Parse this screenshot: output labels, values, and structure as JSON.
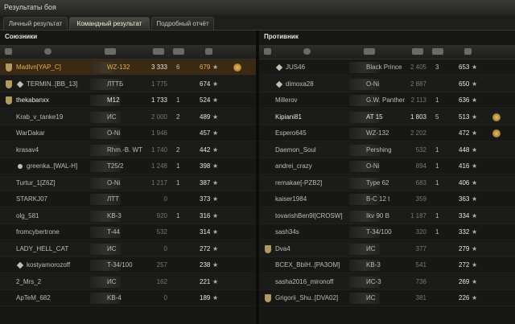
{
  "window": {
    "title": "Результаты боя"
  },
  "tabs": [
    {
      "label": "Личный результат"
    },
    {
      "label": "Командный результат"
    },
    {
      "label": "Подробный отчёт"
    }
  ],
  "allies": {
    "title": "Союзники",
    "rows": [
      {
        "name": "Madlvn[YAP_C]",
        "tank": "WZ-132",
        "damage": "3 333",
        "frags": "6",
        "xp": "679",
        "badge": true,
        "medal": true,
        "style": "me"
      },
      {
        "name": "TERMIN..[BB_13]",
        "tank": "ЛТТБ",
        "damage": "1 775",
        "frags": "",
        "xp": "674",
        "badge": true,
        "diamond": true,
        "style": "normal"
      },
      {
        "name": "thekabanxx",
        "tank": "M12",
        "damage": "1 733",
        "frags": "1",
        "xp": "524",
        "badge": true,
        "style": "bright"
      },
      {
        "name": "Krab_v_tanke19",
        "tank": "ИС",
        "damage": "2 000",
        "frags": "2",
        "xp": "489",
        "style": "normal"
      },
      {
        "name": "WarDakar",
        "tank": "O-Ni",
        "damage": "1 946",
        "frags": "",
        "xp": "457",
        "style": "normal"
      },
      {
        "name": "krasav4",
        "tank": "Rhm.-B. WT",
        "damage": "1 740",
        "frags": "2",
        "xp": "442",
        "style": "normal"
      },
      {
        "name": "greenka..[WAL-H]",
        "tank": "T25/2",
        "damage": "1 248",
        "frags": "1",
        "xp": "398",
        "icon": true,
        "style": "normal"
      },
      {
        "name": "Turtur_1[Z6Z]",
        "tank": "O-Ni",
        "damage": "1 217",
        "frags": "1",
        "xp": "387",
        "style": "normal"
      },
      {
        "name": "STARKJ07",
        "tank": "ЛТТ",
        "damage": "0",
        "frags": "",
        "xp": "373",
        "style": "normal"
      },
      {
        "name": "olg_581",
        "tank": "KB-3",
        "damage": "920",
        "frags": "1",
        "xp": "316",
        "style": "normal"
      },
      {
        "name": "fromcybertrone",
        "tank": "T-44",
        "damage": "532",
        "frags": "",
        "xp": "314",
        "style": "normal"
      },
      {
        "name": "LADY_HELL_CAT",
        "tank": "ИС",
        "damage": "0",
        "frags": "",
        "xp": "272",
        "style": "normal"
      },
      {
        "name": "kostyamorozoff",
        "tank": "T-34/100",
        "damage": "257",
        "frags": "",
        "xp": "238",
        "diamond": true,
        "style": "normal"
      },
      {
        "name": "2_Mrs_2",
        "tank": "ИС",
        "damage": "162",
        "frags": "",
        "xp": "221",
        "style": "normal"
      },
      {
        "name": "ApTeM_682",
        "tank": "KB-4",
        "damage": "0",
        "frags": "",
        "xp": "189",
        "style": "normal"
      }
    ]
  },
  "enemies": {
    "title": "Противник",
    "rows": [
      {
        "name": "JUS46",
        "tank": "Black Prince",
        "damage": "2 405",
        "frags": "3",
        "xp": "653",
        "diamond": true,
        "style": "normal"
      },
      {
        "name": "dimoxa28",
        "tank": "O-Ni",
        "damage": "2 887",
        "frags": "",
        "xp": "650",
        "diamond": true,
        "style": "normal"
      },
      {
        "name": "Millerov",
        "tank": "G.W. Panther",
        "damage": "2 113",
        "frags": "1",
        "xp": "636",
        "style": "normal"
      },
      {
        "name": "Kipiani81",
        "tank": "AT 15",
        "damage": "1 803",
        "frags": "5",
        "xp": "513",
        "medal": true,
        "style": "bright"
      },
      {
        "name": "Espero645",
        "tank": "WZ-132",
        "damage": "2 202",
        "frags": "",
        "xp": "472",
        "medal": true,
        "style": "normal"
      },
      {
        "name": "Daemon_Soul",
        "tank": "Pershing",
        "damage": "532",
        "frags": "1",
        "xp": "448",
        "style": "normal"
      },
      {
        "name": "andrei_crazy",
        "tank": "O-Ni",
        "damage": "894",
        "frags": "1",
        "xp": "416",
        "style": "normal"
      },
      {
        "name": "remakae[-PZB2]",
        "tank": "Type 62",
        "damage": "683",
        "frags": "1",
        "xp": "406",
        "style": "normal"
      },
      {
        "name": "kaiser1984",
        "tank": "B-C 12 t",
        "damage": "359",
        "frags": "",
        "xp": "363",
        "style": "normal"
      },
      {
        "name": "tovarishBen9l[CROSW]",
        "tank": "Ikv 90 B",
        "damage": "1 187",
        "frags": "1",
        "xp": "334",
        "style": "normal"
      },
      {
        "name": "sash34s",
        "tank": "T-34/100",
        "damage": "320",
        "frags": "1",
        "xp": "332",
        "style": "normal"
      },
      {
        "name": "Dva4",
        "tank": "ИС",
        "damage": "377",
        "frags": "",
        "xp": "279",
        "badge": true,
        "style": "normal"
      },
      {
        "name": "BCEX_BbIH..[PA3OM]",
        "tank": "KB-3",
        "damage": "541",
        "frags": "",
        "xp": "272",
        "style": "normal"
      },
      {
        "name": "sasha2016_mironoff",
        "tank": "ИС-3",
        "damage": "736",
        "frags": "",
        "xp": "269",
        "style": "normal"
      },
      {
        "name": "Grigorii_Shu..[DVA02]",
        "tank": "ИС",
        "damage": "381",
        "frags": "",
        "xp": "226",
        "badge": true,
        "style": "normal"
      }
    ]
  },
  "colors": {
    "accent": "#e0b050",
    "row_highlight": "#3a2a14"
  },
  "icons": [
    "medal-icon",
    "star-icon",
    "badge-icon",
    "diamond-icon",
    "tank-icon",
    "sort-arrow-icon"
  ]
}
